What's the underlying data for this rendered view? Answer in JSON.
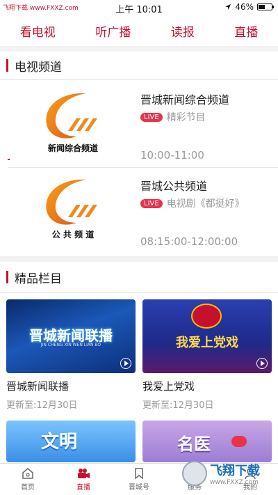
{
  "status_bar": {
    "watermark": "飞翔下载 www.FXXZ.com",
    "time": "上午 10:01",
    "battery": "46%"
  },
  "top_nav": [
    "看电视",
    "听广播",
    "读报",
    "直播"
  ],
  "tv_section": {
    "title": "电视频道",
    "channels": [
      {
        "logo_caption": "新闻综合频道",
        "name": "晋城新闻综合频道",
        "live_badge": "LIVE",
        "program": "精彩节目",
        "time": "10:00-11:00"
      },
      {
        "logo_caption": "公 共 频 道",
        "name": "晋城公共频道",
        "live_badge": "LIVE",
        "program": "电视剧《都挺好》",
        "time": "08:15:00-12:00:00"
      }
    ]
  },
  "featured_section": {
    "title": "精品栏目",
    "programs": [
      {
        "thumb_text": "晋城新闻联播",
        "thumb_sub": "JIN CHENG XIN WEN LIAN BO",
        "title": "晋城新闻联播",
        "updated": "更新至:12月30日"
      },
      {
        "thumb_text": "我爱上党戏",
        "title": "我爱上党戏",
        "updated": "更新至:12月30日"
      },
      {
        "thumb_text": "文明"
      },
      {
        "thumb_text": "名医"
      }
    ]
  },
  "tabbar": {
    "tabs": [
      "首页",
      "直播",
      "晋城号",
      "服务",
      "我的"
    ]
  },
  "watermark_br": {
    "main": "飞翔下载",
    "sub": "www.FXXZ.com"
  },
  "colors": {
    "accent": "#c8102e",
    "live": "#e8334a"
  }
}
